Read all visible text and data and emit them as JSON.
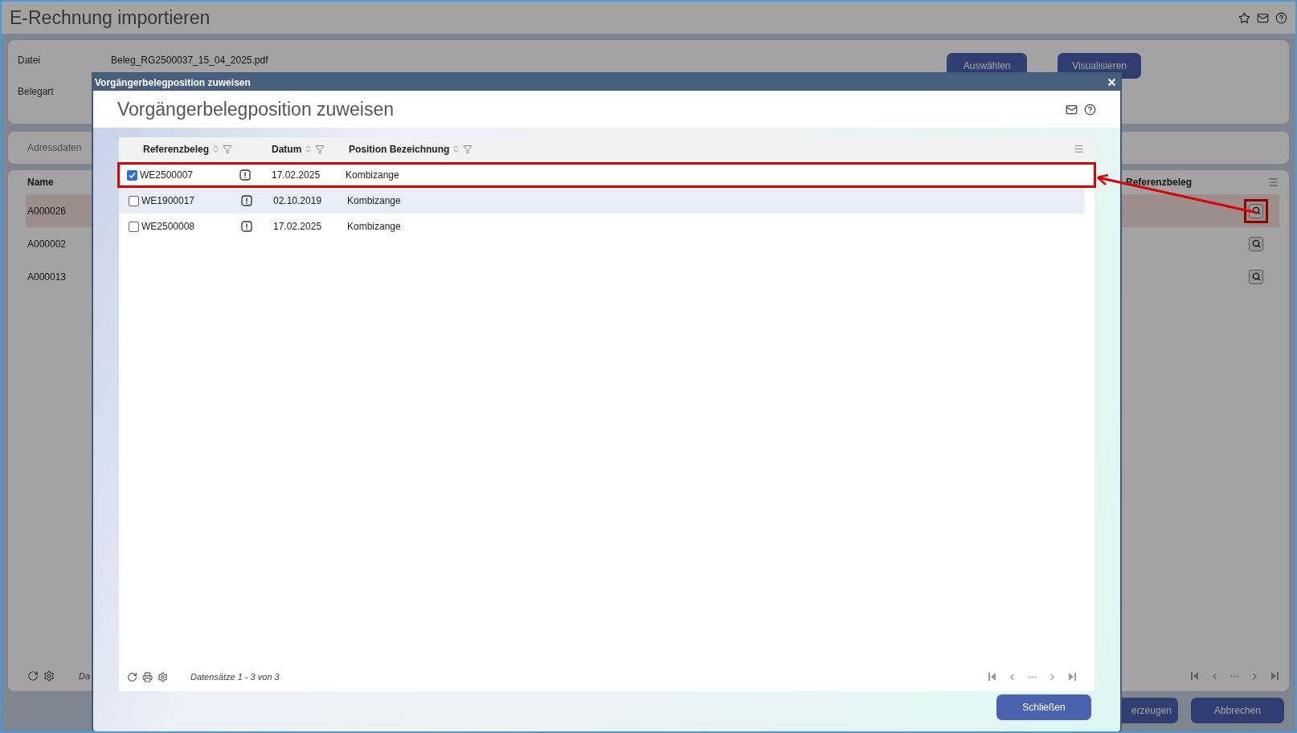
{
  "page": {
    "title": "E-Rechnung importieren"
  },
  "form": {
    "fields": [
      {
        "label": "Datei",
        "value": "Beleg_RG2500037_15_04_2025.pdf"
      },
      {
        "label": "Belegart"
      }
    ],
    "buttons": [
      "Auswählen",
      "Visualisieren"
    ]
  },
  "tab": "Adressdaten",
  "grid": {
    "columns": [
      "Name",
      "Referenzbeleg"
    ],
    "rows": [
      {
        "name": "A000026",
        "selected": true,
        "highlighted": true
      },
      {
        "name": "A000002",
        "selected": false,
        "highlighted": false
      },
      {
        "name": "A000013",
        "selected": false,
        "highlighted": false
      }
    ],
    "footer_text": "Da"
  },
  "actions": [
    "erzeugen",
    "Abbrechen"
  ],
  "dialog": {
    "title_bar": "Vorgängerbelegposition zuweisen",
    "heading": "Vorgängerbelegposition zuweisen",
    "table": {
      "columns": [
        "Referenzbeleg",
        "Datum",
        "Position Bezeichnung"
      ],
      "rows": [
        {
          "checked": true,
          "hovered": false,
          "highlighted": true,
          "reference": "WE2500007",
          "date": "17.02.2025",
          "description": "Kombizange"
        },
        {
          "checked": false,
          "hovered": true,
          "highlighted": false,
          "reference": "WE1900017",
          "date": "02.10.2019",
          "description": "Kombizange"
        },
        {
          "checked": false,
          "hovered": false,
          "highlighted": false,
          "reference": "WE2500008",
          "date": "17.02.2025",
          "description": "Kombizange"
        }
      ]
    },
    "footer_text": "Datensätze 1 - 3 von 3",
    "close_button": "Schließen"
  }
}
